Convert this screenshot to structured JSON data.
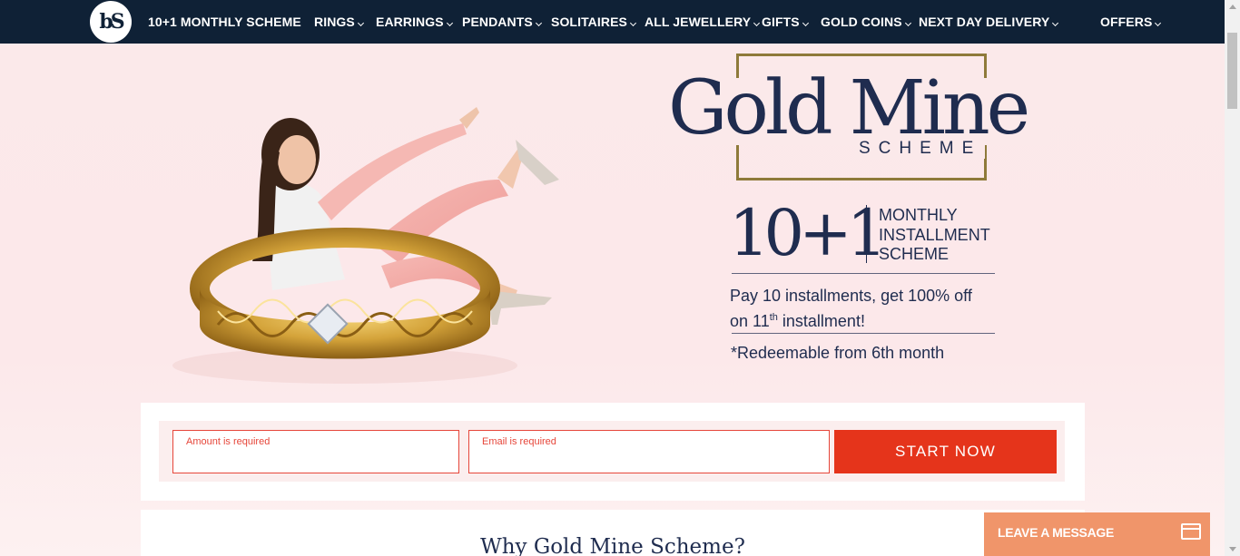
{
  "brand": {
    "logo_text": "bS"
  },
  "nav": {
    "items": [
      {
        "label": "10+1 MONTHLY SCHEME",
        "dropdown": false
      },
      {
        "label": "RINGS",
        "dropdown": true
      },
      {
        "label": "EARRINGS",
        "dropdown": true
      },
      {
        "label": "PENDANTS",
        "dropdown": true
      },
      {
        "label": "SOLITAIRES",
        "dropdown": true
      },
      {
        "label": "ALL JEWELLERY",
        "dropdown": true
      },
      {
        "label": "GIFTS",
        "dropdown": true
      },
      {
        "label": "GOLD COINS",
        "dropdown": true
      },
      {
        "label": "NEXT DAY DELIVERY",
        "dropdown": true
      },
      {
        "label": "OFFERS",
        "dropdown": true
      }
    ]
  },
  "hero": {
    "title": "Gold Mine",
    "subtitle": "SCHEME",
    "big_number": "10+1",
    "monthly_lines": [
      "MONTHLY",
      "INSTALLMENT",
      "SCHEME"
    ],
    "offer_line1": "Pay 10 installments, get 100% off",
    "offer_line2_prefix": "on 11",
    "offer_line2_sup": "th",
    "offer_line2_suffix": " installment!",
    "redeem": "*Redeemable from 6th month"
  },
  "form": {
    "amount_label": "Amount is required",
    "email_label": "Email is required",
    "amount_value": "",
    "email_value": "",
    "start_label": "START NOW"
  },
  "why": {
    "title": "Why Gold Mine Scheme?"
  },
  "chat": {
    "label": "LEAVE A MESSAGE"
  },
  "colors": {
    "nav_bg": "#0f2136",
    "navy_text": "#1f2c4f",
    "gold_frame": "#8e7a3a",
    "start_button": "#e5341b",
    "chat_widget": "#f0956a",
    "error": "#e6463a"
  }
}
